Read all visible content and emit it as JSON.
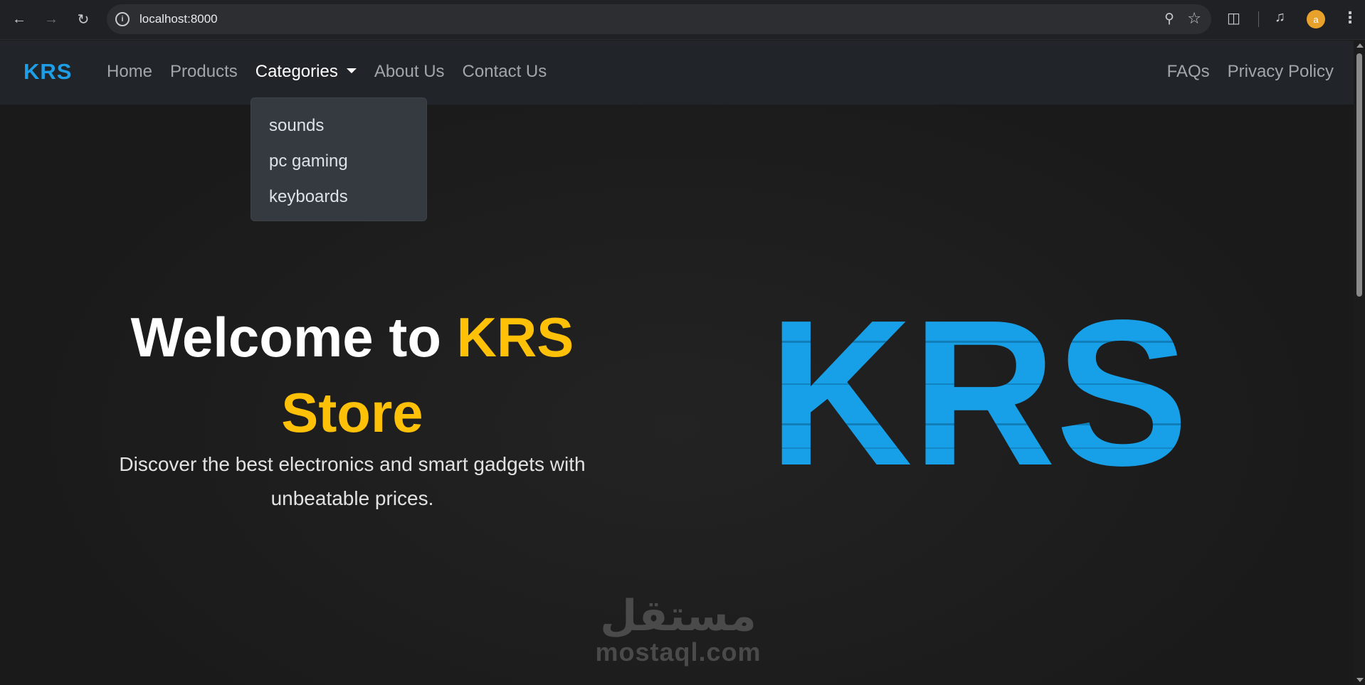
{
  "browser": {
    "url": "localhost:8000",
    "profile_initial": "a",
    "icons": {
      "back": "arrow-left-icon",
      "forward": "arrow-right-icon",
      "reload": "reload-icon",
      "site_info": "info-icon",
      "zoom": "zoom-icon",
      "bookmark": "star-icon",
      "extensions": "puzzle-icon",
      "media": "media-controls-icon",
      "menu": "kebab-menu-icon"
    }
  },
  "navbar": {
    "brand": "KRS",
    "links": [
      "Home",
      "Products",
      "Categories",
      "About Us",
      "Contact Us"
    ],
    "right_links": [
      "FAQs",
      "Privacy Policy"
    ],
    "active": "Categories"
  },
  "dropdown": {
    "items": [
      "sounds",
      "pc gaming",
      "keyboards"
    ]
  },
  "hero": {
    "title_prefix": "Welcome to ",
    "title_highlight": "KRS Store",
    "subtitle": "Discover the best electronics and smart gadgets with unbeatable prices.",
    "logo_text": "KRS"
  },
  "watermark": {
    "arabic": "مستقل",
    "latin": "mostaql.com"
  },
  "colors": {
    "brand_blue": "#1d9ee7",
    "accent_yellow": "#ffc107",
    "navbar_bg": "#212529",
    "dropdown_bg": "#343a40"
  }
}
